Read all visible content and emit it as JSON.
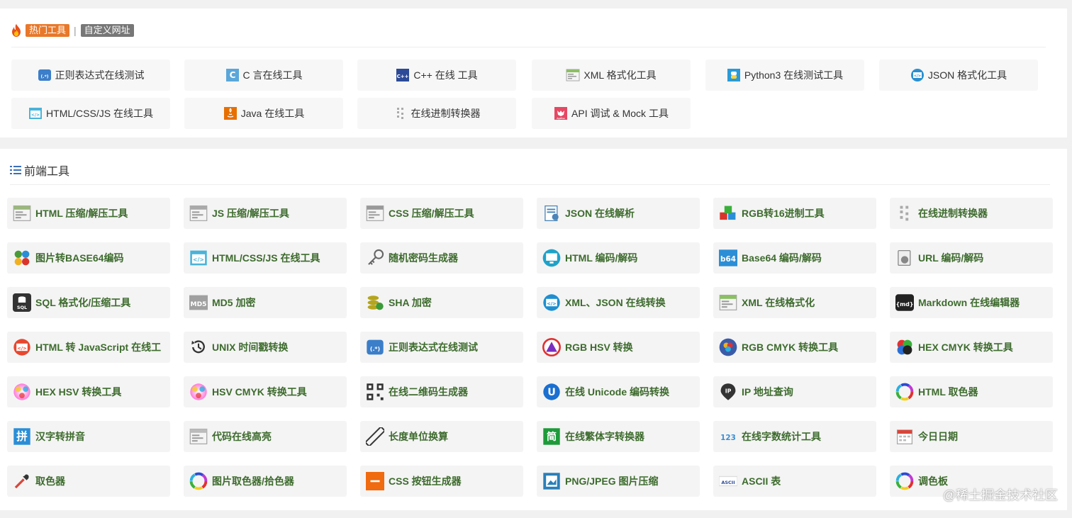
{
  "hot": {
    "tag_hot": "热门工具",
    "separator": "|",
    "tag_custom": "自定义网址",
    "items": [
      {
        "label": "正则表达式在线测试",
        "icon": "regex-icon",
        "color": "#3b7ec9"
      },
      {
        "label": "C 言在线工具",
        "icon": "c-lang-icon",
        "color": "#5aa7d9"
      },
      {
        "label": "C++ 在线 工具",
        "icon": "cpp-icon",
        "color": "#2c4a97"
      },
      {
        "label": "XML 格式化工具",
        "icon": "xml-icon",
        "color": "#8bbf63"
      },
      {
        "label": "Python3 在线测试工具",
        "icon": "python-icon",
        "color": "#2a9bd8"
      },
      {
        "label": "JSON 格式化工具",
        "icon": "json-icon",
        "color": "#2a8fd0"
      },
      {
        "label": "HTML/CSS/JS 在线工具",
        "icon": "html-css-js-icon",
        "color": "#4ab3d9"
      },
      {
        "label": "Java 在线工具",
        "icon": "java-icon",
        "color": "#e76f00"
      },
      {
        "label": "在线进制转换器",
        "icon": "binary-icon",
        "color": "#aaaaaa"
      },
      {
        "label": "API 调试 & Mock 工具",
        "icon": "apifox-icon",
        "color": "#e54864"
      }
    ]
  },
  "frontend": {
    "title": "前端工具",
    "items": [
      {
        "label": "HTML 压缩/解压工具",
        "icon": "html-compress-icon",
        "color": "#9bb77c"
      },
      {
        "label": "JS 压缩/解压工具",
        "icon": "js-compress-icon",
        "color": "#aaaaaa"
      },
      {
        "label": "CSS 压缩/解压工具",
        "icon": "css-compress-icon",
        "color": "#999999"
      },
      {
        "label": "JSON 在线解析",
        "icon": "json-parse-icon",
        "color": "#4a84b8"
      },
      {
        "label": "RGB转16进制工具",
        "icon": "rgb-hex-icon",
        "color": "#d9342b"
      },
      {
        "label": "在线进制转换器",
        "icon": "binary-icon",
        "color": "#aaaaaa"
      },
      {
        "label": "图片转BASE64编码",
        "icon": "image-base64-icon",
        "color": "#4a9a3a"
      },
      {
        "label": "HTML/CSS/JS 在线工具",
        "icon": "html-css-js-icon",
        "color": "#4ab3d9"
      },
      {
        "label": "随机密码生成器",
        "icon": "key-icon",
        "color": "#666666"
      },
      {
        "label": "HTML 编码/解码",
        "icon": "monitor-icon",
        "color": "#1fa2c9"
      },
      {
        "label": "Base64 编码/解码",
        "icon": "b64-icon",
        "color": "#2b8ed6"
      },
      {
        "label": "URL 编码/解码",
        "icon": "url-icon",
        "color": "#888888"
      },
      {
        "label": "SQL 格式化/压缩工具",
        "icon": "sql-icon",
        "color": "#333333"
      },
      {
        "label": "MD5 加密",
        "icon": "md5-icon",
        "color": "#a0a0a0"
      },
      {
        "label": "SHA 加密",
        "icon": "sha-icon",
        "color": "#b5a51e"
      },
      {
        "label": "XML、JSON 在线转换",
        "icon": "xml-json-icon",
        "color": "#1e8fd0"
      },
      {
        "label": "XML 在线格式化",
        "icon": "xml-format-icon",
        "color": "#8bbf63"
      },
      {
        "label": "Markdown 在线编辑器",
        "icon": "markdown-icon",
        "color": "#222222"
      },
      {
        "label": "HTML 转 JavaScript 在线工",
        "icon": "html-js-icon",
        "color": "#e8472f"
      },
      {
        "label": "UNIX 时间戳转换",
        "icon": "history-icon",
        "color": "#333333"
      },
      {
        "label": "正则表达式在线测试",
        "icon": "regex-icon",
        "color": "#3b7ec9"
      },
      {
        "label": "RGB HSV 转换",
        "icon": "rgb-hsv-icon",
        "color": "#7b2fc0"
      },
      {
        "label": "RGB CMYK 转换工具",
        "icon": "rgb-cmyk-icon",
        "color": "#3a5ba8"
      },
      {
        "label": "HEX CMYK 转换工具",
        "icon": "hex-cmyk-icon",
        "color": "#e23030"
      },
      {
        "label": "HEX HSV 转换工具",
        "icon": "hex-hsv-icon",
        "color": "#f07ad0"
      },
      {
        "label": "HSV CMYK 转换工具",
        "icon": "hsv-cmyk-icon",
        "color": "#e58ad8"
      },
      {
        "label": "在线二维码生成器",
        "icon": "qrcode-icon",
        "color": "#333333"
      },
      {
        "label": "在线 Unicode 编码转换",
        "icon": "unicode-icon",
        "color": "#1a6fd0"
      },
      {
        "label": "IP 地址查询",
        "icon": "location-pin-icon",
        "color": "#333333"
      },
      {
        "label": "HTML 取色器",
        "icon": "color-wheel-icon",
        "color": "#e23030"
      },
      {
        "label": "汉字转拼音",
        "icon": "pinyin-icon",
        "color": "#2a8ed6"
      },
      {
        "label": "代码在线高亮",
        "icon": "code-highlight-icon",
        "color": "#bbbbbb"
      },
      {
        "label": "长度单位换算",
        "icon": "ruler-icon",
        "color": "#333333"
      },
      {
        "label": "在线繁体字转换器",
        "icon": "traditional-chinese-icon",
        "color": "#1e9a3a"
      },
      {
        "label": "在线字数统计工具",
        "icon": "word-count-icon",
        "color": "#3a8ed6"
      },
      {
        "label": "今日日期",
        "icon": "calendar-icon",
        "color": "#d9463a"
      },
      {
        "label": "取色器",
        "icon": "eyedropper-icon",
        "color": "#d9463a"
      },
      {
        "label": "图片取色器/拾色器",
        "icon": "image-picker-icon",
        "color": "#b43fd0"
      },
      {
        "label": "CSS 按钮生成器",
        "icon": "css-button-icon",
        "color": "#f06a10"
      },
      {
        "label": "PNG/JPEG 图片压缩",
        "icon": "image-compress-icon",
        "color": "#2a7fb8"
      },
      {
        "label": "ASCII 表",
        "icon": "ascii-icon",
        "color": "#2c4a97"
      },
      {
        "label": "调色板",
        "icon": "palette-icon",
        "color": "#e23030"
      }
    ]
  },
  "icon_texts": {
    "regex": "(.*)",
    "c": "C",
    "cpp": "C++",
    "b64": "b64",
    "md5": "MD5",
    "md": "{md}",
    "pinyin": "拼",
    "fan": "简",
    "count": "123",
    "ascii": "ASCII",
    "unicode": "U",
    "ip": "IP",
    "sql": "SQL",
    "api": "ApiFox"
  },
  "watermark": "@稀土掘金技术社区"
}
